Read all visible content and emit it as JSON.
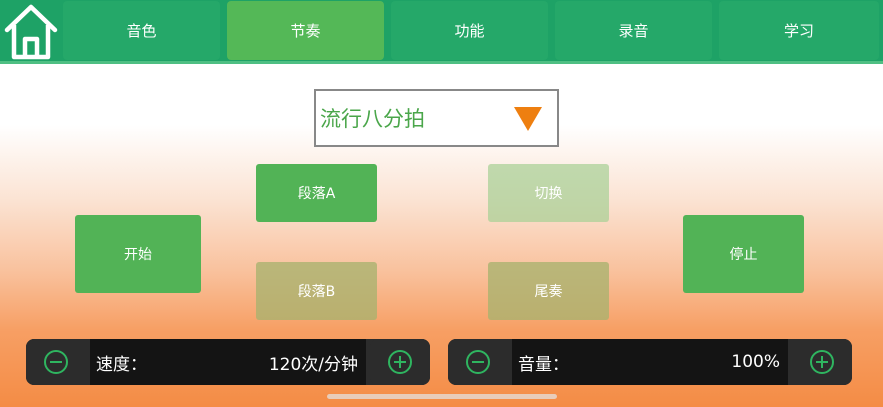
{
  "tabs": [
    {
      "label": "音色",
      "active": false
    },
    {
      "label": "节奏",
      "active": true
    },
    {
      "label": "功能",
      "active": false
    },
    {
      "label": "录音",
      "active": false
    },
    {
      "label": "学习",
      "active": false
    }
  ],
  "rhythm": {
    "selected": "流行八分拍"
  },
  "pads": {
    "start": "开始",
    "section_a": "段落A",
    "section_b": "段落B",
    "switch": "切换",
    "ending": "尾奏",
    "stop": "停止"
  },
  "tempo": {
    "label": "速度：",
    "value": "120次/分钟"
  },
  "volume": {
    "label": "音量：",
    "value": "100%"
  },
  "colors": {
    "topbar": "#1ea266",
    "tab": "#25a869",
    "tab_active": "#54b857",
    "pad_green": "#52b356",
    "accent_orange": "#ee7f10",
    "icon_green": "#2fb560"
  },
  "icons": {
    "home": "home-icon",
    "dropdown": "triangle-down-icon",
    "decrease": "minus-circle-icon",
    "increase": "plus-circle-icon"
  }
}
